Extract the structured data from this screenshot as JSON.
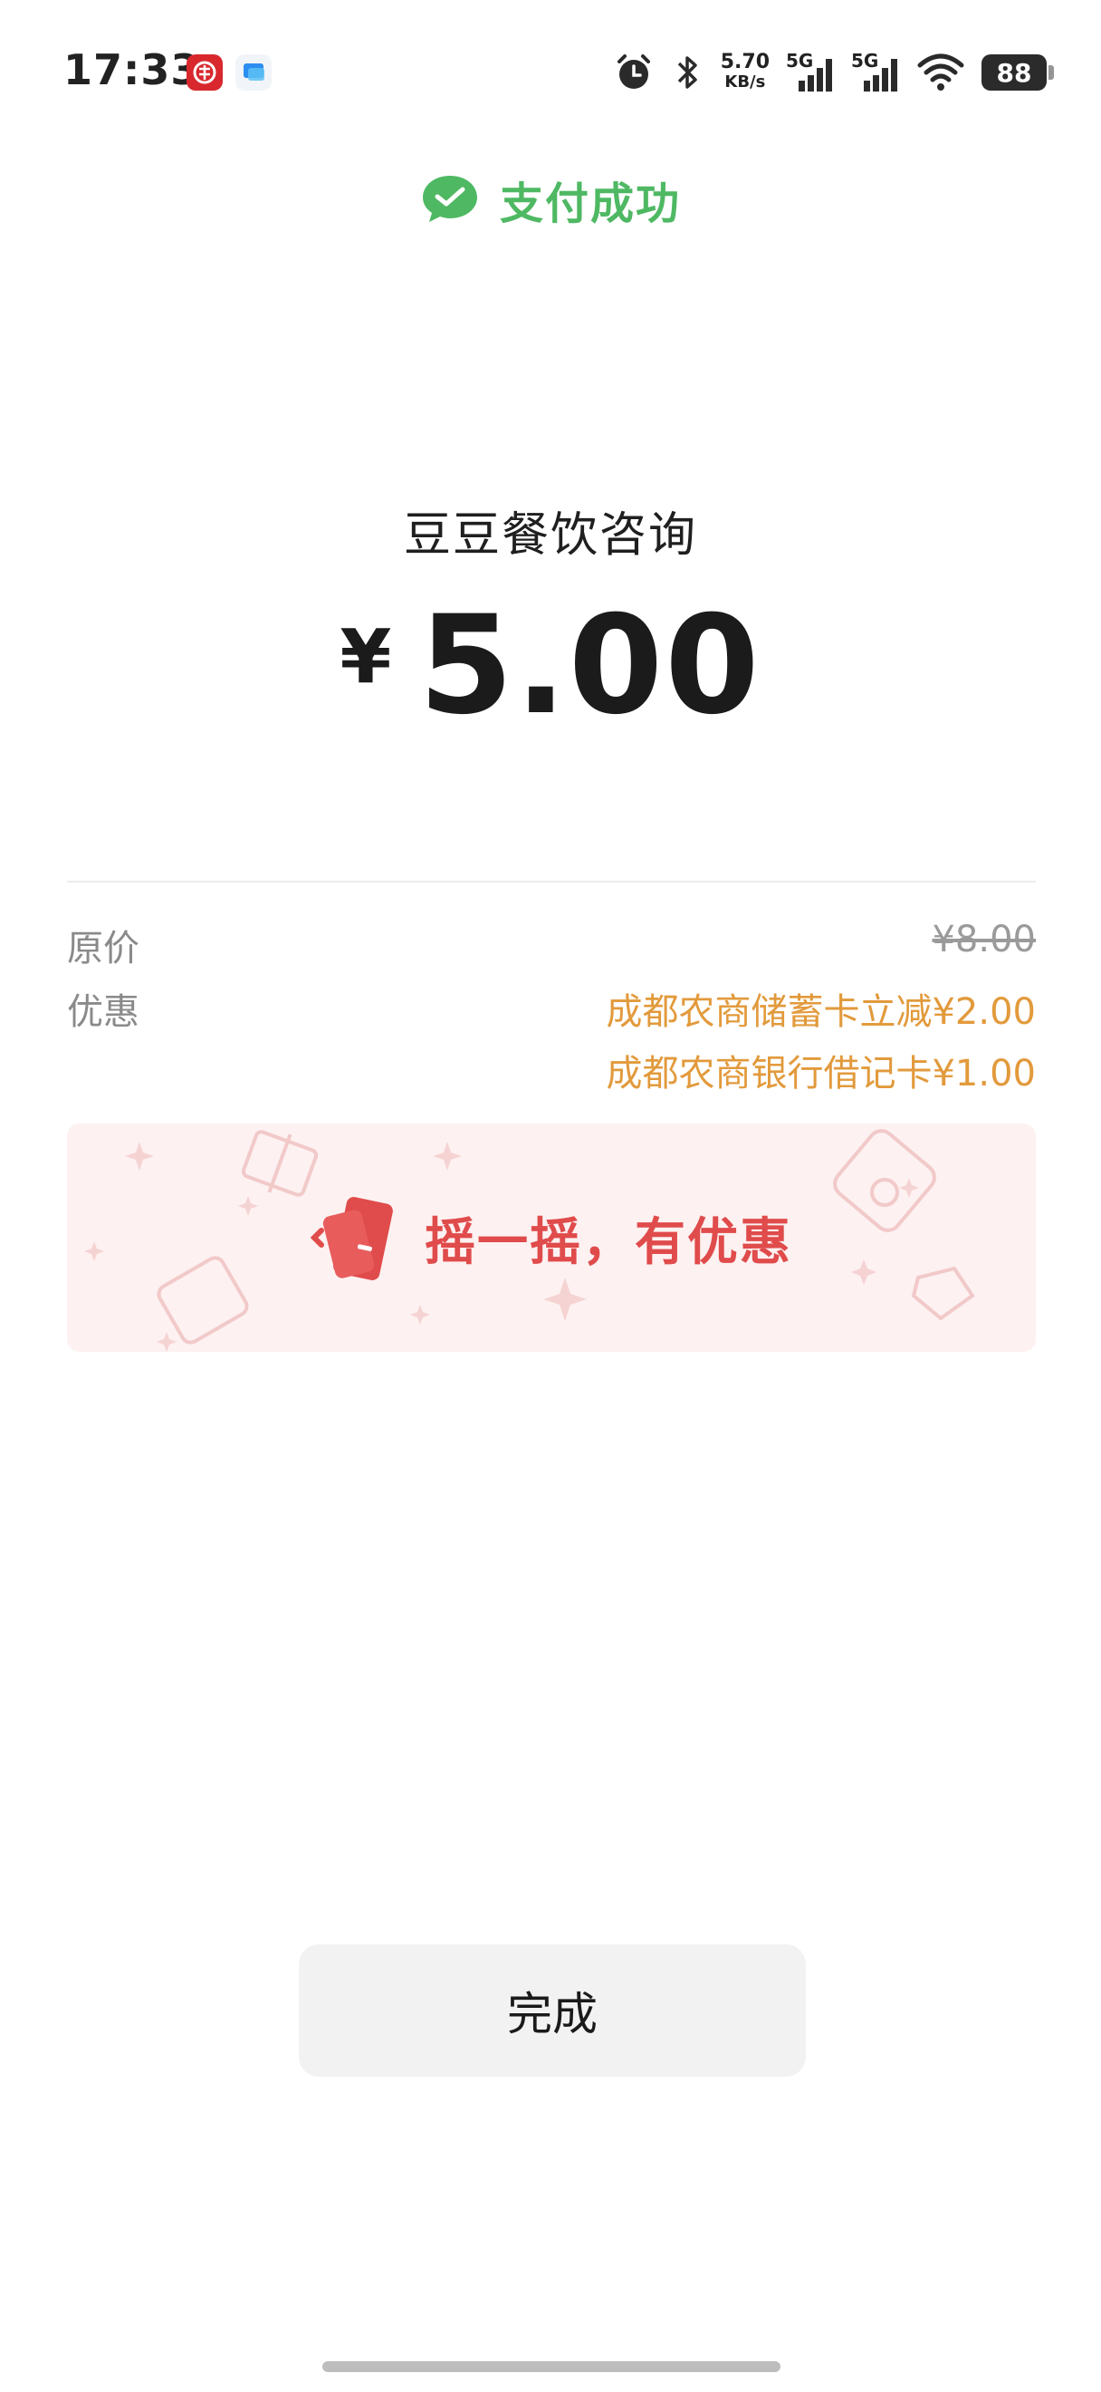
{
  "status_bar": {
    "time": "17:33",
    "net_speed_value": "5.70",
    "net_speed_unit": "KB/s",
    "signal_1_label": "5G",
    "signal_2_label": "5G",
    "battery": "88",
    "icons": [
      "app-notification-icon",
      "blue-app-icon",
      "alarm-icon",
      "bluetooth-icon",
      "signal-icon",
      "wifi-icon",
      "battery-icon"
    ]
  },
  "header": {
    "title": "支付成功",
    "icon": "wechat-pay-check-icon",
    "accent_color": "#4fb863"
  },
  "payment": {
    "merchant": "豆豆餐饮咨询",
    "currency": "¥",
    "amount": "5.00"
  },
  "details": {
    "original_price_label": "原价",
    "original_price_value": "¥8.00",
    "discount_label": "优惠",
    "discounts": [
      "成都农商储蓄卡立减¥2.00",
      "成都农商银行借记卡¥1.00"
    ],
    "discount_color": "#e29a3c"
  },
  "banner": {
    "text": "摇一摇，有优惠",
    "icon": "shake-phone-icon",
    "text_color": "#e04b4b"
  },
  "footer": {
    "done_label": "完成"
  }
}
